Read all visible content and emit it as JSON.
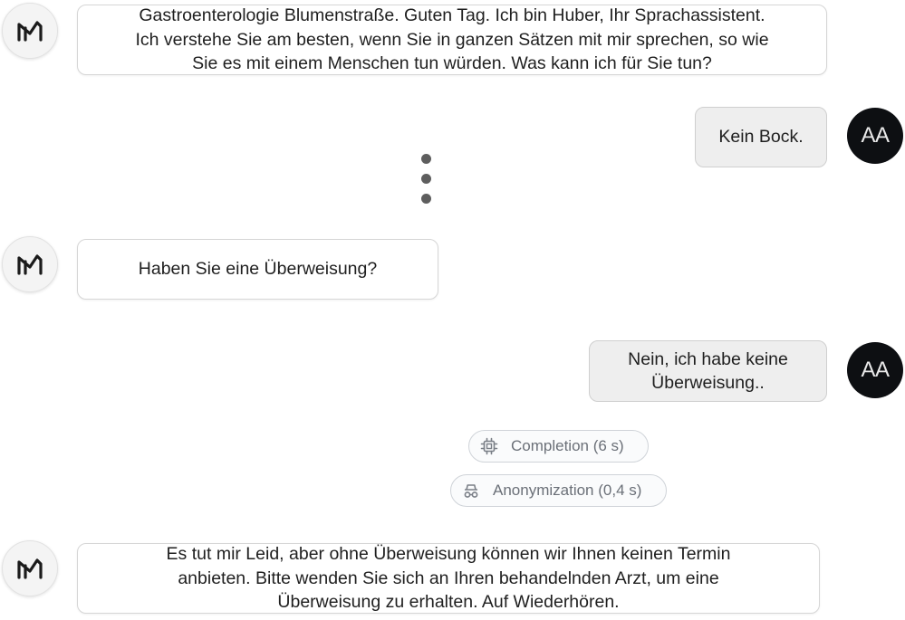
{
  "messages": [
    {
      "role": "bot",
      "lines": [
        "Gastroenterologie Blumenstraße. Guten Tag. Ich bin Huber, Ihr Sprachassistent.",
        "Ich verstehe Sie am besten, wenn Sie in ganzen Sätzen mit mir sprechen, so wie",
        "Sie es mit einem Menschen tun würden. Was kann ich für Sie tun?"
      ]
    },
    {
      "role": "user",
      "avatar_initials": "AA",
      "lines": [
        "Kein Bock."
      ]
    },
    {
      "role": "bot",
      "lines": [
        "Haben Sie eine Überweisung?"
      ]
    },
    {
      "role": "user",
      "avatar_initials": "AA",
      "lines": [
        "Nein, ich habe keine",
        "Überweisung.."
      ]
    },
    {
      "role": "bot",
      "lines": [
        "Es tut mir Leid, aber ohne Überweisung können wir Ihnen keinen Termin",
        "anbieten. Bitte wenden Sie sich an Ihren behandelnden Arzt, um eine",
        "Überweisung zu erhalten. Auf Wiederhören."
      ]
    }
  ],
  "chips": [
    {
      "label": "Completion (6 s)",
      "icon": "cpu-chip-icon"
    },
    {
      "label": "Anonymization (0,4 s)",
      "icon": "incognito-icon"
    }
  ],
  "ellipsis_icon": "vertical-ellipsis-icon",
  "bot_avatar_icon": "bot-logo-icon",
  "colors": {
    "user_avatar_bg": "#0d0f12",
    "user_bubble_bg": "#eeeeee",
    "bot_bubble_bg": "#ffffff",
    "chip_text": "#6b7078"
  }
}
